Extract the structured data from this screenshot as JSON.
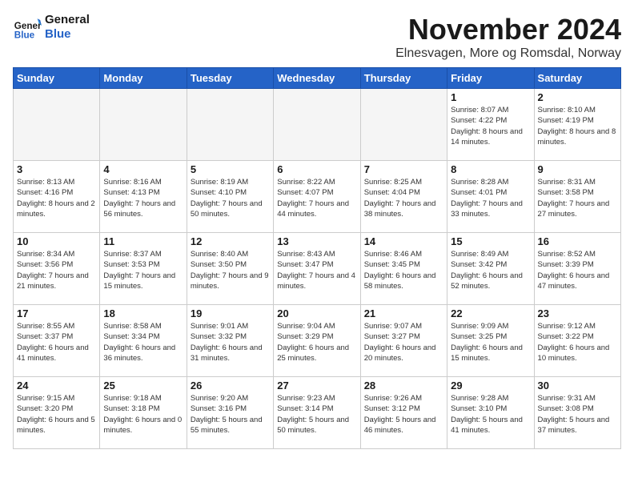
{
  "header": {
    "logo_general": "General",
    "logo_blue": "Blue",
    "month": "November 2024",
    "location": "Elnesvagen, More og Romsdal, Norway"
  },
  "weekdays": [
    "Sunday",
    "Monday",
    "Tuesday",
    "Wednesday",
    "Thursday",
    "Friday",
    "Saturday"
  ],
  "weeks": [
    [
      {
        "day": "",
        "info": ""
      },
      {
        "day": "",
        "info": ""
      },
      {
        "day": "",
        "info": ""
      },
      {
        "day": "",
        "info": ""
      },
      {
        "day": "",
        "info": ""
      },
      {
        "day": "1",
        "info": "Sunrise: 8:07 AM\nSunset: 4:22 PM\nDaylight: 8 hours\nand 14 minutes."
      },
      {
        "day": "2",
        "info": "Sunrise: 8:10 AM\nSunset: 4:19 PM\nDaylight: 8 hours\nand 8 minutes."
      }
    ],
    [
      {
        "day": "3",
        "info": "Sunrise: 8:13 AM\nSunset: 4:16 PM\nDaylight: 8 hours\nand 2 minutes."
      },
      {
        "day": "4",
        "info": "Sunrise: 8:16 AM\nSunset: 4:13 PM\nDaylight: 7 hours\nand 56 minutes."
      },
      {
        "day": "5",
        "info": "Sunrise: 8:19 AM\nSunset: 4:10 PM\nDaylight: 7 hours\nand 50 minutes."
      },
      {
        "day": "6",
        "info": "Sunrise: 8:22 AM\nSunset: 4:07 PM\nDaylight: 7 hours\nand 44 minutes."
      },
      {
        "day": "7",
        "info": "Sunrise: 8:25 AM\nSunset: 4:04 PM\nDaylight: 7 hours\nand 38 minutes."
      },
      {
        "day": "8",
        "info": "Sunrise: 8:28 AM\nSunset: 4:01 PM\nDaylight: 7 hours\nand 33 minutes."
      },
      {
        "day": "9",
        "info": "Sunrise: 8:31 AM\nSunset: 3:58 PM\nDaylight: 7 hours\nand 27 minutes."
      }
    ],
    [
      {
        "day": "10",
        "info": "Sunrise: 8:34 AM\nSunset: 3:56 PM\nDaylight: 7 hours\nand 21 minutes."
      },
      {
        "day": "11",
        "info": "Sunrise: 8:37 AM\nSunset: 3:53 PM\nDaylight: 7 hours\nand 15 minutes."
      },
      {
        "day": "12",
        "info": "Sunrise: 8:40 AM\nSunset: 3:50 PM\nDaylight: 7 hours\nand 9 minutes."
      },
      {
        "day": "13",
        "info": "Sunrise: 8:43 AM\nSunset: 3:47 PM\nDaylight: 7 hours\nand 4 minutes."
      },
      {
        "day": "14",
        "info": "Sunrise: 8:46 AM\nSunset: 3:45 PM\nDaylight: 6 hours\nand 58 minutes."
      },
      {
        "day": "15",
        "info": "Sunrise: 8:49 AM\nSunset: 3:42 PM\nDaylight: 6 hours\nand 52 minutes."
      },
      {
        "day": "16",
        "info": "Sunrise: 8:52 AM\nSunset: 3:39 PM\nDaylight: 6 hours\nand 47 minutes."
      }
    ],
    [
      {
        "day": "17",
        "info": "Sunrise: 8:55 AM\nSunset: 3:37 PM\nDaylight: 6 hours\nand 41 minutes."
      },
      {
        "day": "18",
        "info": "Sunrise: 8:58 AM\nSunset: 3:34 PM\nDaylight: 6 hours\nand 36 minutes."
      },
      {
        "day": "19",
        "info": "Sunrise: 9:01 AM\nSunset: 3:32 PM\nDaylight: 6 hours\nand 31 minutes."
      },
      {
        "day": "20",
        "info": "Sunrise: 9:04 AM\nSunset: 3:29 PM\nDaylight: 6 hours\nand 25 minutes."
      },
      {
        "day": "21",
        "info": "Sunrise: 9:07 AM\nSunset: 3:27 PM\nDaylight: 6 hours\nand 20 minutes."
      },
      {
        "day": "22",
        "info": "Sunrise: 9:09 AM\nSunset: 3:25 PM\nDaylight: 6 hours\nand 15 minutes."
      },
      {
        "day": "23",
        "info": "Sunrise: 9:12 AM\nSunset: 3:22 PM\nDaylight: 6 hours\nand 10 minutes."
      }
    ],
    [
      {
        "day": "24",
        "info": "Sunrise: 9:15 AM\nSunset: 3:20 PM\nDaylight: 6 hours\nand 5 minutes."
      },
      {
        "day": "25",
        "info": "Sunrise: 9:18 AM\nSunset: 3:18 PM\nDaylight: 6 hours\nand 0 minutes."
      },
      {
        "day": "26",
        "info": "Sunrise: 9:20 AM\nSunset: 3:16 PM\nDaylight: 5 hours\nand 55 minutes."
      },
      {
        "day": "27",
        "info": "Sunrise: 9:23 AM\nSunset: 3:14 PM\nDaylight: 5 hours\nand 50 minutes."
      },
      {
        "day": "28",
        "info": "Sunrise: 9:26 AM\nSunset: 3:12 PM\nDaylight: 5 hours\nand 46 minutes."
      },
      {
        "day": "29",
        "info": "Sunrise: 9:28 AM\nSunset: 3:10 PM\nDaylight: 5 hours\nand 41 minutes."
      },
      {
        "day": "30",
        "info": "Sunrise: 9:31 AM\nSunset: 3:08 PM\nDaylight: 5 hours\nand 37 minutes."
      }
    ]
  ]
}
